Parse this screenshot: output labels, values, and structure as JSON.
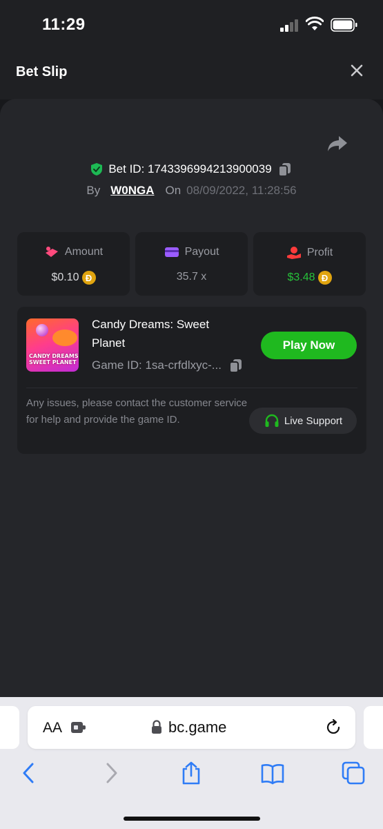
{
  "status_bar": {
    "time": "11:29"
  },
  "header": {
    "title": "Bet Slip"
  },
  "bet": {
    "id_text": "Bet ID: 1743396994213900039",
    "by_label": "By",
    "user": "W0NGA",
    "on_label": "On",
    "date": "08/09/2022, 11:28:56"
  },
  "stats": {
    "amount": {
      "label": "Amount",
      "value": "$0.10",
      "color": "#d8d9dc"
    },
    "payout": {
      "label": "Payout",
      "value": "35.7 x",
      "color": "#9a9ca3"
    },
    "profit": {
      "label": "Profit",
      "value": "$3.48",
      "color": "#27c23a"
    },
    "coin_symbol": "Đ"
  },
  "game": {
    "title": "Candy Dreams: Sweet Planet",
    "thumb_text": "CANDY DREAMS SWEET PLANET",
    "id_text": "Game ID: 1sa-crfdlxyc-...",
    "play_label": "Play Now",
    "help_text": "Any issues, please contact the customer service for help and provide the game ID.",
    "support_label": "Live Support"
  },
  "browser": {
    "text_size_label": "AA",
    "url": "bc.game"
  },
  "colors": {
    "accent_green": "#1fb91f",
    "profit_green": "#27c23a",
    "shield_green": "#1db954",
    "coin_gold": "#e0a40f",
    "ios_blue": "#2f7cf6"
  },
  "icons": [
    "shield-icon",
    "copy-icon",
    "share-icon",
    "close-icon",
    "amount-icon",
    "payout-icon",
    "profit-icon",
    "coin-icon",
    "headset-icon",
    "lock-icon",
    "reload-icon",
    "back-icon",
    "forward-icon",
    "share-sheet-icon",
    "bookmarks-icon",
    "tabs-icon"
  ]
}
